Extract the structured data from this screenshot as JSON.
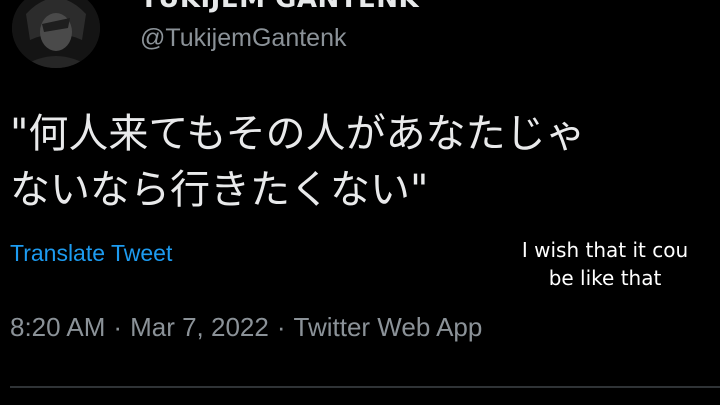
{
  "user": {
    "display_name": "TUKIJEM GANTENK",
    "handle": "@TukijemGantenk",
    "avatar_icon": "avatar-photo-icon"
  },
  "tweet": {
    "text_line1": "\"何人来てもその人があなたじゃ",
    "text_line2": "ないなら行きたくない\"",
    "translate_label": "Translate Tweet",
    "time": "8:20 AM",
    "separator": "·",
    "date": "Mar 7, 2022",
    "source": "Twitter Web App"
  },
  "caption": {
    "line1": "I wish that it cou",
    "line2": "be like that"
  },
  "colors": {
    "background": "#000000",
    "text": "#e7e9ea",
    "muted": "#8b9298",
    "link": "#1d9bf0"
  }
}
